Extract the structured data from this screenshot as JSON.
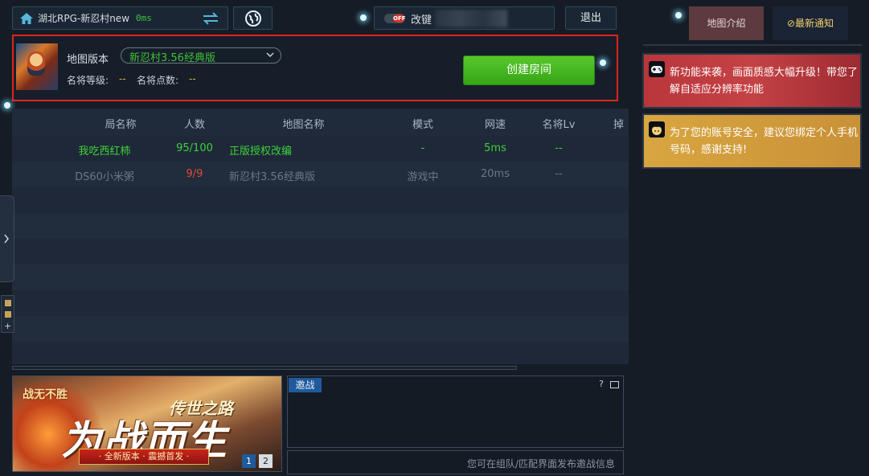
{
  "topbar": {
    "room_name": "湖北RPG-新忍村new",
    "ping": "0ms",
    "key_toggle_state": "OFF",
    "key_label": "改键",
    "exit_label": "退出"
  },
  "map_panel": {
    "map_version_label": "地图版本",
    "map_version_value": "新忍村3.56经典版",
    "rank_label": "名将等级:",
    "rank_value": "--",
    "points_label": "名将点数:",
    "points_value": "--",
    "create_room_label": "创建房间"
  },
  "table": {
    "columns": [
      "局名称",
      "人数",
      "地图名称",
      "模式",
      "网速",
      "名将Lv",
      "掉"
    ],
    "rows": [
      {
        "name": "我吃西红柿",
        "players": "95/100",
        "map": "正版授权改编",
        "mode": "-",
        "speed": "5ms",
        "lv": "--",
        "color": "#3fd13a",
        "players_color": "#3fd13a"
      },
      {
        "name": "DS60小米粥",
        "players": "9/9",
        "map": "新忍村3.56经典版",
        "mode": "游戏中",
        "speed": "20ms",
        "lv": "--",
        "color": "#6c7886",
        "players_color": "#e04a3a"
      }
    ]
  },
  "banner": {
    "logo_text": "战无不胜",
    "subtitle": "传世之路",
    "headline": "为战而生",
    "ribbon": "· 全新版本 · 震撼首发 ·",
    "pages": [
      "1",
      "2"
    ]
  },
  "invite": {
    "tab_label": "邀战",
    "help": "?",
    "placeholder": "您可在组队/匹配界面发布邀战信息"
  },
  "right": {
    "tab_intro": "地图介绍",
    "tab_news": "最新通知",
    "notices": [
      {
        "text": "新功能来袭，画面质感大幅升级！带您了解自适应分辨率功能"
      },
      {
        "text": "为了您的账号安全，建议您绑定个人手机号码，感谢支持!"
      }
    ]
  },
  "colors": {
    "accent_green": "#3fd13a",
    "highlight_red": "#e0231f",
    "gold": "#e7b53a"
  }
}
